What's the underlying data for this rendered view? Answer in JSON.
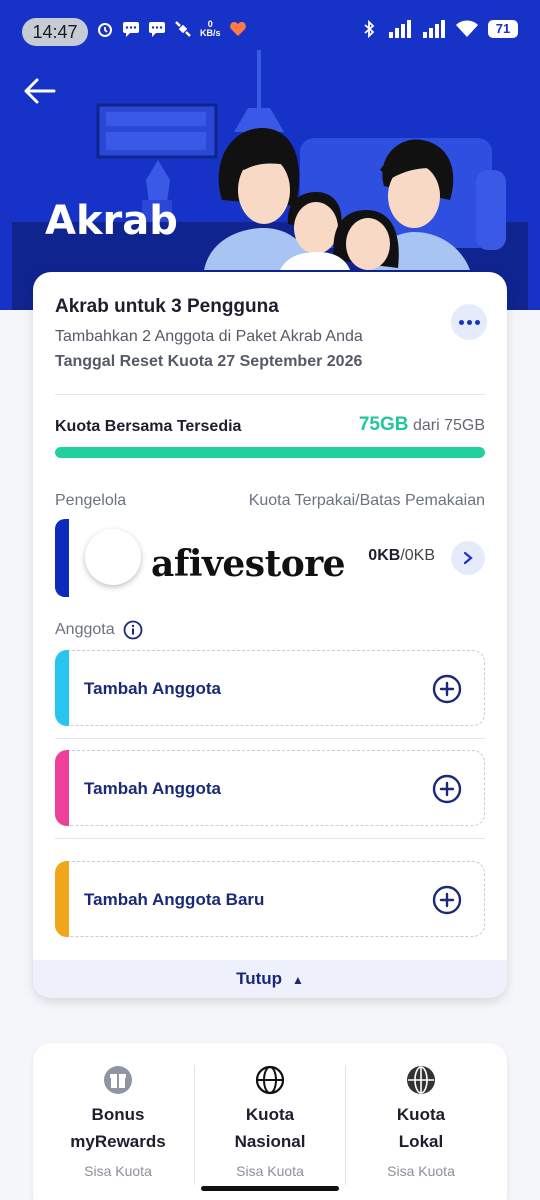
{
  "status_bar": {
    "time": "14:47",
    "net_speed_value": "0",
    "net_speed_unit": "KB/s",
    "battery": "71"
  },
  "header": {
    "title": "Akrab"
  },
  "plan": {
    "title": "Akrab untuk 3 Pengguna",
    "subtitle": "Tambahkan 2 Anggota di Paket Akrab Anda",
    "reset": "Tanggal Reset Kuota 27 September 2026",
    "quota_label": "Kuota Bersama Tersedia",
    "quota_available": "75GB",
    "quota_of": "dari 75GB",
    "quota_fraction": 1.0
  },
  "manager": {
    "column_left": "Pengelola",
    "column_right": "Kuota Terpakai/Batas Pemakaian",
    "name": "afivestore",
    "usage_used": "0KB",
    "usage_limit": "/0KB",
    "color": "#0b2bbd"
  },
  "members": {
    "label": "Anggota",
    "items": [
      {
        "label": "Tambah Anggota",
        "color": "#27c6f0"
      },
      {
        "label": "Tambah Anggota",
        "color": "#ee3f9a"
      },
      {
        "label": "Tambah Anggota Baru",
        "color": "#f0a51a"
      }
    ]
  },
  "collapse": {
    "label": "Tutup"
  },
  "bonuses": [
    {
      "title_line1": "Bonus",
      "title_line2": "myRewards",
      "sub": "Sisa Kuota",
      "icon": "gift-icon"
    },
    {
      "title_line1": "Kuota",
      "title_line2": "Nasional",
      "sub": "Sisa Kuota",
      "icon": "globe-icon"
    },
    {
      "title_line1": "Kuota",
      "title_line2": "Lokal",
      "sub": "Sisa Kuota",
      "icon": "globe-dark-icon"
    }
  ],
  "colors": {
    "brand": "#1733c7",
    "quota": "#21d09c",
    "member_text": "#1a2a78"
  }
}
